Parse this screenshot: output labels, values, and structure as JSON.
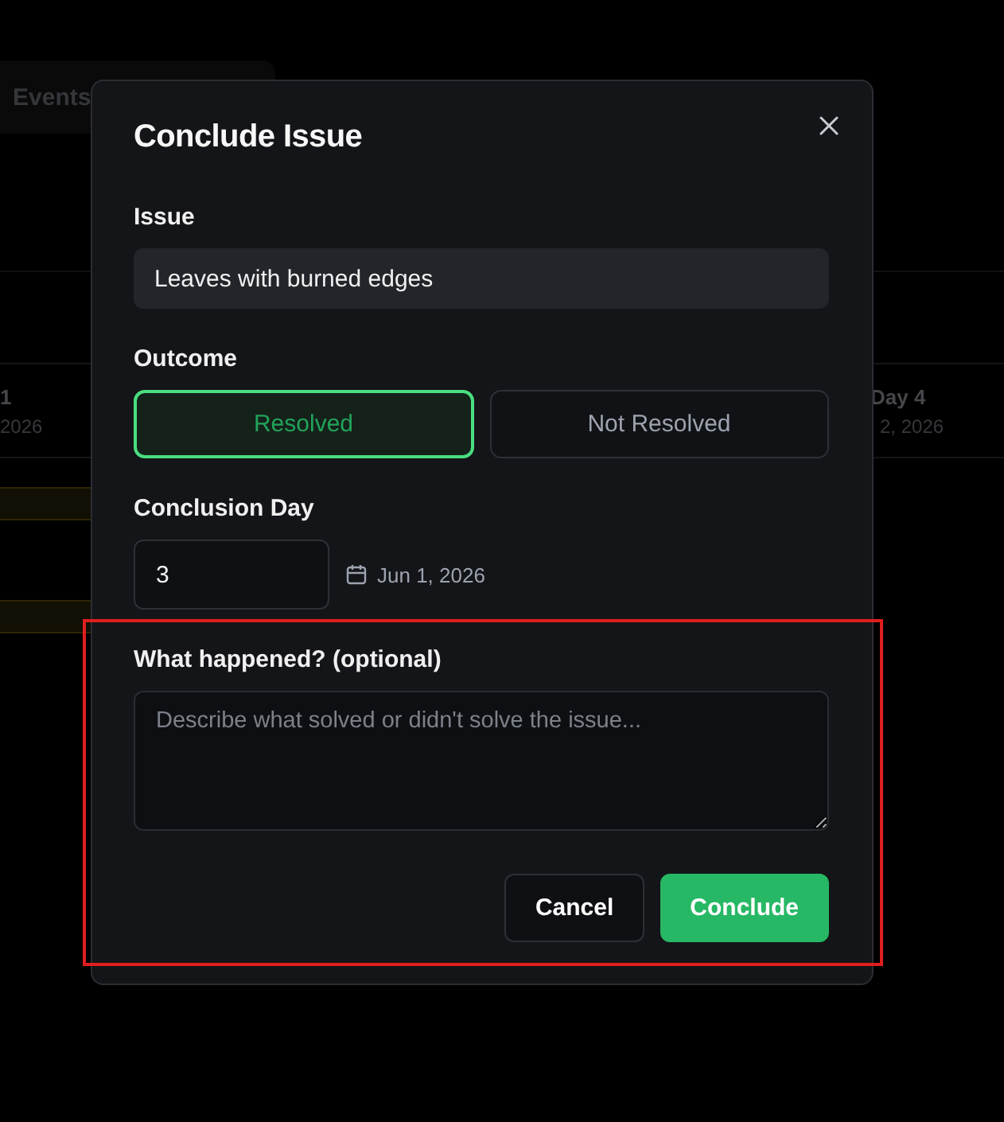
{
  "background": {
    "tab": {
      "label": "Events"
    },
    "day_columns": [
      {
        "title": "1",
        "date": "2026"
      },
      {
        "title": "Day 4",
        "date": "2, 2026"
      }
    ]
  },
  "dialog": {
    "title": "Conclude Issue",
    "issue": {
      "label": "Issue",
      "value": "Leaves with burned edges"
    },
    "outcome": {
      "label": "Outcome",
      "options": [
        {
          "label": "Resolved",
          "selected": true
        },
        {
          "label": "Not Resolved",
          "selected": false
        }
      ]
    },
    "conclusion_day": {
      "label": "Conclusion Day",
      "value": "3",
      "date": "Jun 1, 2026"
    },
    "notes": {
      "label": "What happened? (optional)",
      "placeholder": "Describe what solved or didn't solve the issue...",
      "highlighted": true
    },
    "buttons": [
      {
        "label": "Cancel",
        "kind": "secondary"
      },
      {
        "label": "Conclude",
        "kind": "primary"
      }
    ]
  }
}
